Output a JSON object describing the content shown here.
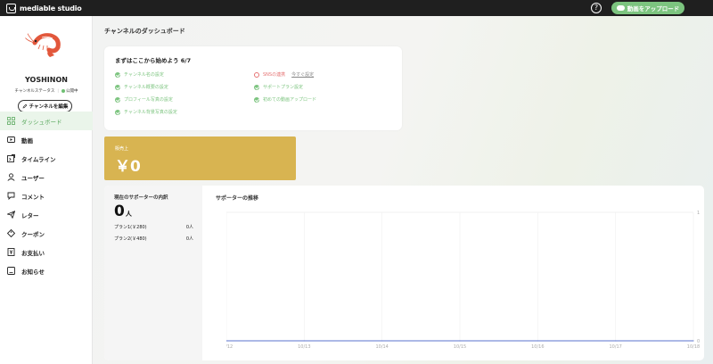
{
  "topbar": {
    "logo_text": "mediable studio",
    "help_symbol": "?",
    "upload_label": "動画をアップロード"
  },
  "profile": {
    "name": "YOSHINON",
    "channel_status": "チャンネルステータス",
    "status": "公開中",
    "separator": "|",
    "edit_button": "チャンネルを編集"
  },
  "nav": {
    "items": [
      {
        "label": "ダッシュボード",
        "icon": "dashboard-icon",
        "active": true
      },
      {
        "label": "動画",
        "icon": "video-icon"
      },
      {
        "label": "タイムライン",
        "icon": "timeline-icon"
      },
      {
        "label": "ユーザー",
        "icon": "user-icon"
      },
      {
        "label": "コメント",
        "icon": "comment-icon"
      },
      {
        "label": "レター",
        "icon": "letter-icon"
      },
      {
        "label": "クーポン",
        "icon": "coupon-icon"
      },
      {
        "label": "お支払い",
        "icon": "payment-icon"
      },
      {
        "label": "お知らせ",
        "icon": "notice-icon"
      }
    ]
  },
  "main": {
    "page_title": "チャンネルのダッシュボード",
    "checklist": {
      "title": "まずはここから始めよう 6/7",
      "done_items": [
        "チャンネル名の設定",
        "チャンネル概要の設定",
        "プロフィール写真の設定",
        "チャンネル背景写真の設定",
        "サポートプラン設定",
        "初めての動画アップロード"
      ],
      "todo_item": "SNSの連携",
      "todo_link": "今すぐ設定"
    },
    "sales": {
      "label": "販売上",
      "value": "￥0"
    },
    "supporters": {
      "title": "現在のサポーターの内訳",
      "count": "0",
      "unit": "人",
      "plans": [
        {
          "name": "プラン1(￥280)",
          "count": "0人"
        },
        {
          "name": "プラン2(￥480)",
          "count": "0人"
        }
      ]
    },
    "chart_title": "サポーターの推移"
  },
  "colors": {
    "accent": "#7cc47f",
    "sales_card": "#d8b451",
    "todo": "#e57373",
    "chart_line": "#7a8fd6"
  },
  "chart_data": {
    "type": "line",
    "title": "サポーターの推移",
    "x": [
      "10/12",
      "10/13",
      "10/14",
      "10/15",
      "10/16",
      "10/17",
      "10/18"
    ],
    "series": [
      {
        "values": [
          0,
          0,
          0,
          0,
          0,
          0,
          0
        ]
      }
    ],
    "y_ticks": [
      "1",
      "0"
    ],
    "ylim": [
      0,
      1
    ],
    "grid": true
  }
}
